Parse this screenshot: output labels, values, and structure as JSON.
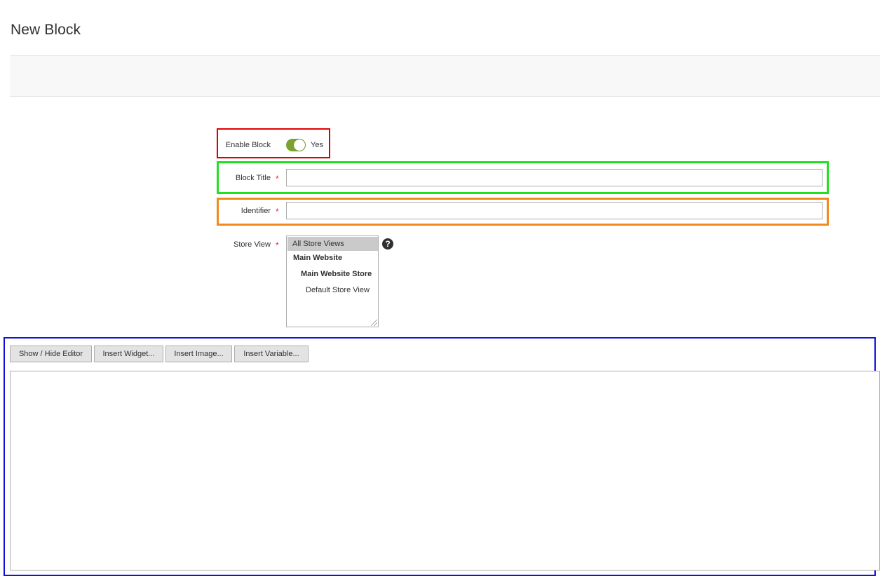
{
  "page": {
    "title": "New Block"
  },
  "form": {
    "enable_block": {
      "label": "Enable Block",
      "state_text": "Yes",
      "enabled": true,
      "toggle_color": "#79a22e"
    },
    "block_title": {
      "label": "Block Title",
      "required_mark": "*",
      "value": ""
    },
    "identifier": {
      "label": "Identifier",
      "required_mark": "*",
      "value": ""
    },
    "store_view": {
      "label": "Store View",
      "required_mark": "*",
      "help_icon": "?",
      "options": [
        {
          "label": "All Store Views",
          "selected": true
        },
        {
          "label": "Main Website",
          "selected": false
        },
        {
          "label": "Main Website Store",
          "selected": false
        },
        {
          "label": "Default Store View",
          "selected": false
        }
      ]
    }
  },
  "editor": {
    "buttons": {
      "show_hide": "Show / Hide Editor",
      "insert_widget": "Insert Widget...",
      "insert_image": "Insert Image...",
      "insert_variable": "Insert Variable..."
    },
    "content": ""
  },
  "highlight_colors": {
    "enable": "#e00000",
    "title": "#22e022",
    "identifier": "#f08a1c",
    "editor": "#1111dd"
  }
}
